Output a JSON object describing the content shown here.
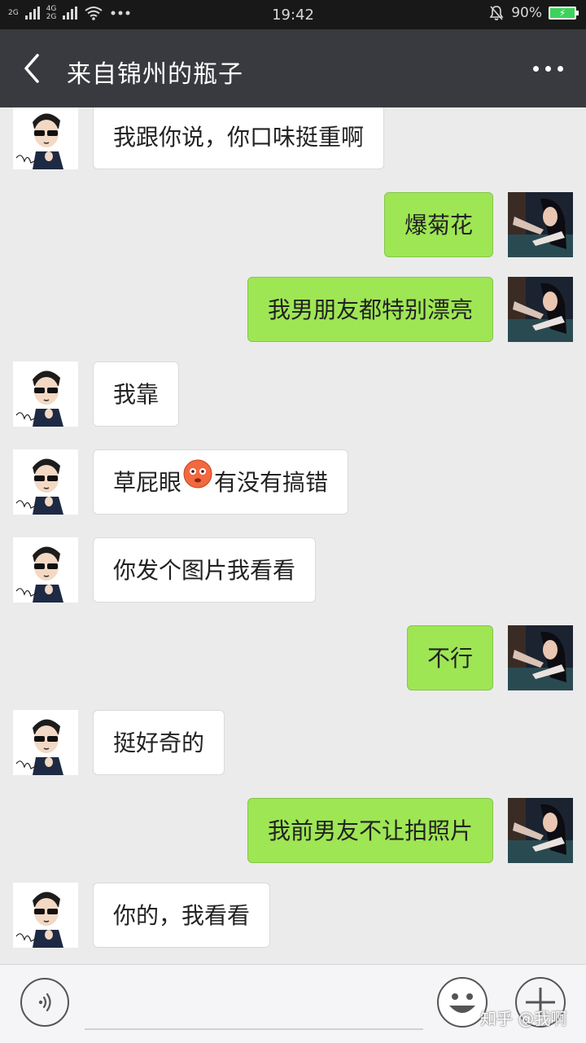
{
  "status_bar": {
    "net_top": "2G",
    "net_mid": "4G",
    "net_bot": "2G",
    "time": "19:42",
    "battery": "90%"
  },
  "header": {
    "title": "来自锦州的瓶子"
  },
  "messages": [
    {
      "side": "left",
      "text": "我跟你说，你口味挺重啊"
    },
    {
      "side": "right",
      "text": "爆菊花"
    },
    {
      "side": "right",
      "text": "我男朋友都特别漂亮"
    },
    {
      "side": "left",
      "text": "我靠"
    },
    {
      "side": "left",
      "text_before": "草屁眼",
      "emoji": "flushed-face",
      "text_after": "有没有搞错"
    },
    {
      "side": "left",
      "text": "你发个图片我看看"
    },
    {
      "side": "right",
      "text": "不行"
    },
    {
      "side": "left",
      "text": "挺好奇的"
    },
    {
      "side": "right",
      "text": "我前男友不让拍照片"
    },
    {
      "side": "left",
      "text": "你的，我看看"
    }
  ],
  "watermark": "知乎 @我啊",
  "colors": {
    "title_bar": "#393a3f",
    "status_bar": "#181818",
    "chat_bg": "#ebebeb",
    "bubble_self": "#9ee654",
    "bubble_other": "#ffffff"
  }
}
